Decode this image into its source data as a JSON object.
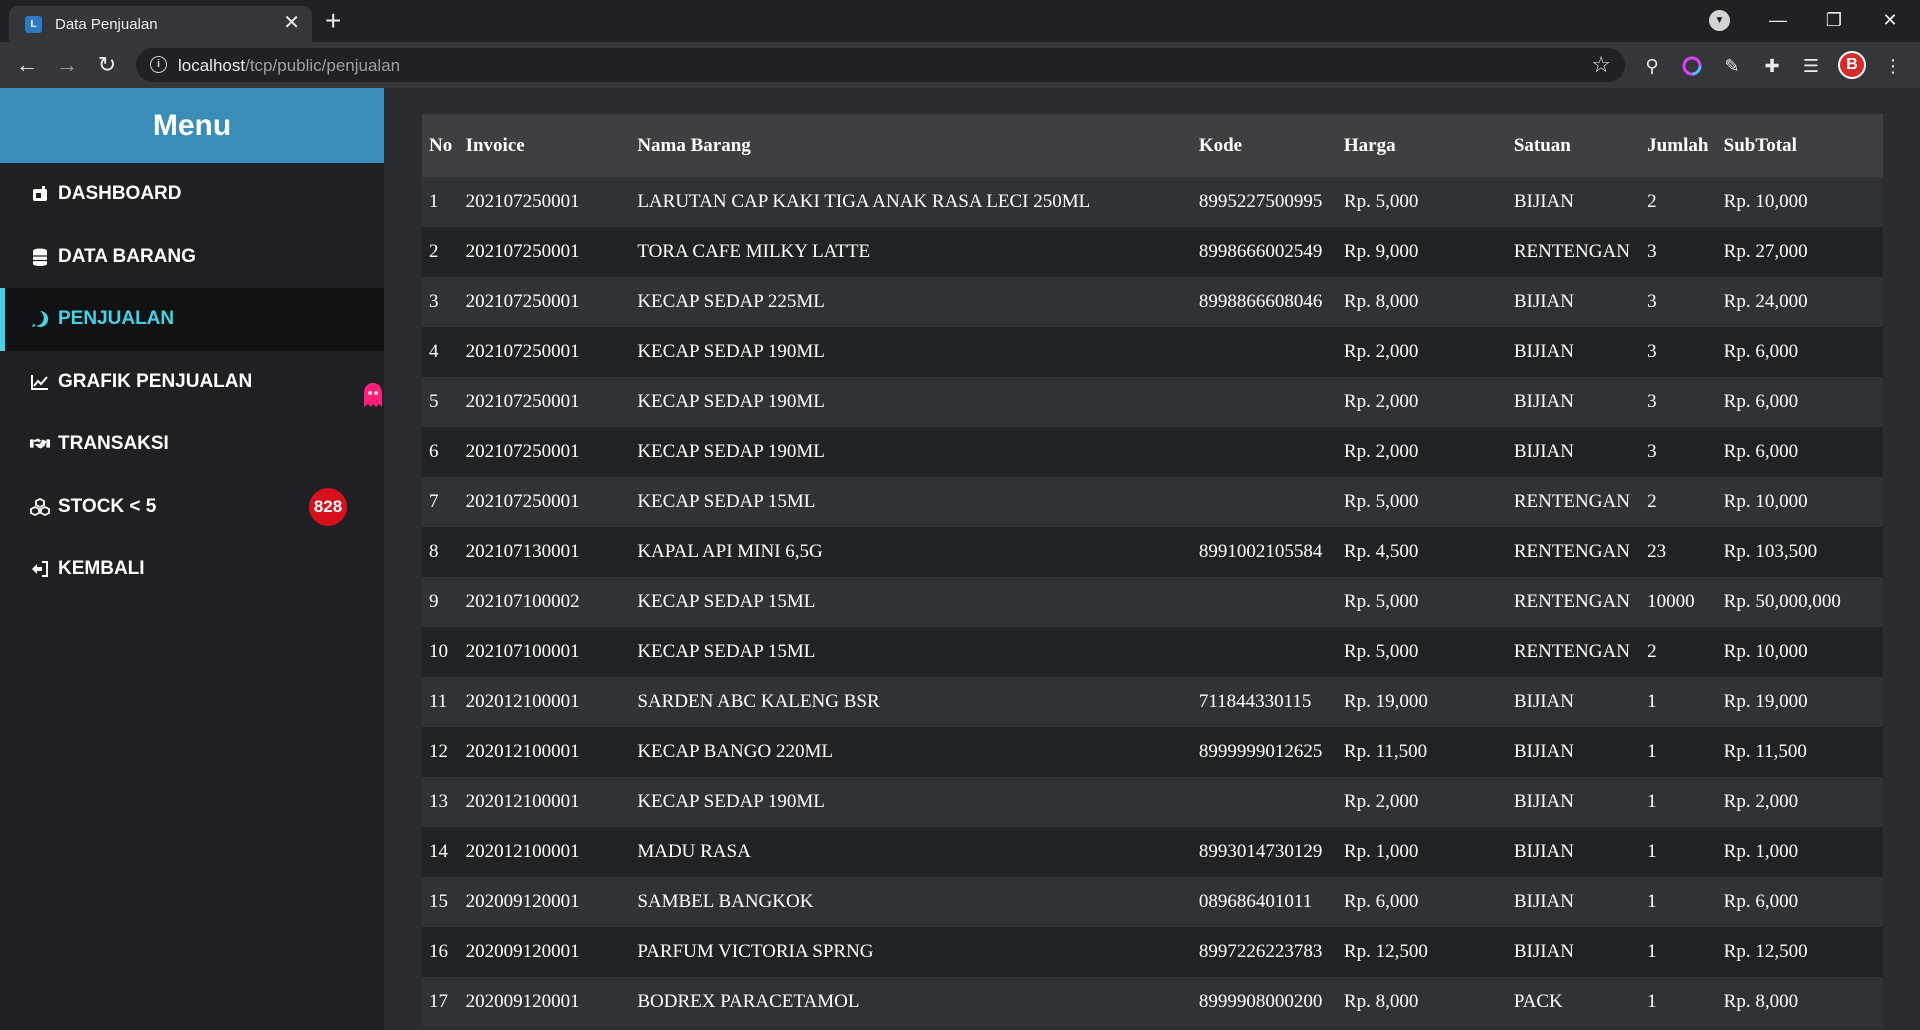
{
  "browser": {
    "tab_title": "Data Penjualan",
    "url_host": "localhost",
    "url_path": "/tcp/public/penjualan"
  },
  "sidebar": {
    "title": "Menu",
    "items": [
      {
        "label": "DASHBOARD",
        "icon": "dashboard-icon"
      },
      {
        "label": "DATA BARANG",
        "icon": "database-icon"
      },
      {
        "label": "PENJUALAN",
        "icon": "sales-icon"
      },
      {
        "label": "GRAFIK PENJUALAN",
        "icon": "chart-line-icon"
      },
      {
        "label": "TRANSAKSI",
        "icon": "handshake-icon"
      },
      {
        "label": "STOCK < 5",
        "icon": "cubes-icon",
        "badge": "828"
      },
      {
        "label": "KEMBALI",
        "icon": "sign-out-icon"
      }
    ],
    "active_color": "#45d3e3",
    "badge_color": "#d8101c"
  },
  "table": {
    "headers": [
      "No",
      "Invoice",
      "Nama Barang",
      "Kode",
      "Harga",
      "Satuan",
      "Jumlah",
      "SubTotal"
    ],
    "rows": [
      [
        "1",
        "202107250001",
        "LARUTAN CAP KAKI TIGA ANAK RASA LECI 250ML",
        "8995227500995",
        "Rp. 5,000",
        "BIJIAN",
        "2",
        "Rp. 10,000"
      ],
      [
        "2",
        "202107250001",
        "TORA CAFE MILKY LATTE",
        "8998666002549",
        "Rp. 9,000",
        "RENTENGAN",
        "3",
        "Rp. 27,000"
      ],
      [
        "3",
        "202107250001",
        "KECAP SEDAP 225ML",
        "8998866608046",
        "Rp. 8,000",
        "BIJIAN",
        "3",
        "Rp. 24,000"
      ],
      [
        "4",
        "202107250001",
        "KECAP SEDAP 190ML",
        "",
        "Rp. 2,000",
        "BIJIAN",
        "3",
        "Rp. 6,000"
      ],
      [
        "5",
        "202107250001",
        "KECAP SEDAP 190ML",
        "",
        "Rp. 2,000",
        "BIJIAN",
        "3",
        "Rp. 6,000"
      ],
      [
        "6",
        "202107250001",
        "KECAP SEDAP 190ML",
        "",
        "Rp. 2,000",
        "BIJIAN",
        "3",
        "Rp. 6,000"
      ],
      [
        "7",
        "202107250001",
        "KECAP SEDAP 15ML",
        "",
        "Rp. 5,000",
        "RENTENGAN",
        "2",
        "Rp. 10,000"
      ],
      [
        "8",
        "202107130001",
        "KAPAL API MINI 6,5G",
        "8991002105584",
        "Rp. 4,500",
        "RENTENGAN",
        "23",
        "Rp. 103,500"
      ],
      [
        "9",
        "202107100002",
        "KECAP SEDAP 15ML",
        "",
        "Rp. 5,000",
        "RENTENGAN",
        "10000",
        "Rp. 50,000,000"
      ],
      [
        "10",
        "202107100001",
        "KECAP SEDAP 15ML",
        "",
        "Rp. 5,000",
        "RENTENGAN",
        "2",
        "Rp. 10,000"
      ],
      [
        "11",
        "202012100001",
        "SARDEN ABC KALENG BSR",
        "711844330115",
        "Rp. 19,000",
        "BIJIAN",
        "1",
        "Rp. 19,000"
      ],
      [
        "12",
        "202012100001",
        "KECAP BANGO 220ML",
        "8999999012625",
        "Rp. 11,500",
        "BIJIAN",
        "1",
        "Rp. 11,500"
      ],
      [
        "13",
        "202012100001",
        "KECAP SEDAP 190ML",
        "",
        "Rp. 2,000",
        "BIJIAN",
        "1",
        "Rp. 2,000"
      ],
      [
        "14",
        "202012100001",
        "MADU RASA",
        "8993014730129",
        "Rp. 1,000",
        "BIJIAN",
        "1",
        "Rp. 1,000"
      ],
      [
        "15",
        "202009120001",
        "SAMBEL BANGKOK",
        "089686401011",
        "Rp. 6,000",
        "BIJIAN",
        "1",
        "Rp. 6,000"
      ],
      [
        "16",
        "202009120001",
        "PARFUM VICTORIA SPRNG",
        "8997226223783",
        "Rp. 12,500",
        "BIJIAN",
        "1",
        "Rp. 12,500"
      ],
      [
        "17",
        "202009120001",
        "BODREX PARACETAMOL",
        "8999908000200",
        "Rp. 8,000",
        "PACK",
        "1",
        "Rp. 8,000"
      ]
    ]
  }
}
